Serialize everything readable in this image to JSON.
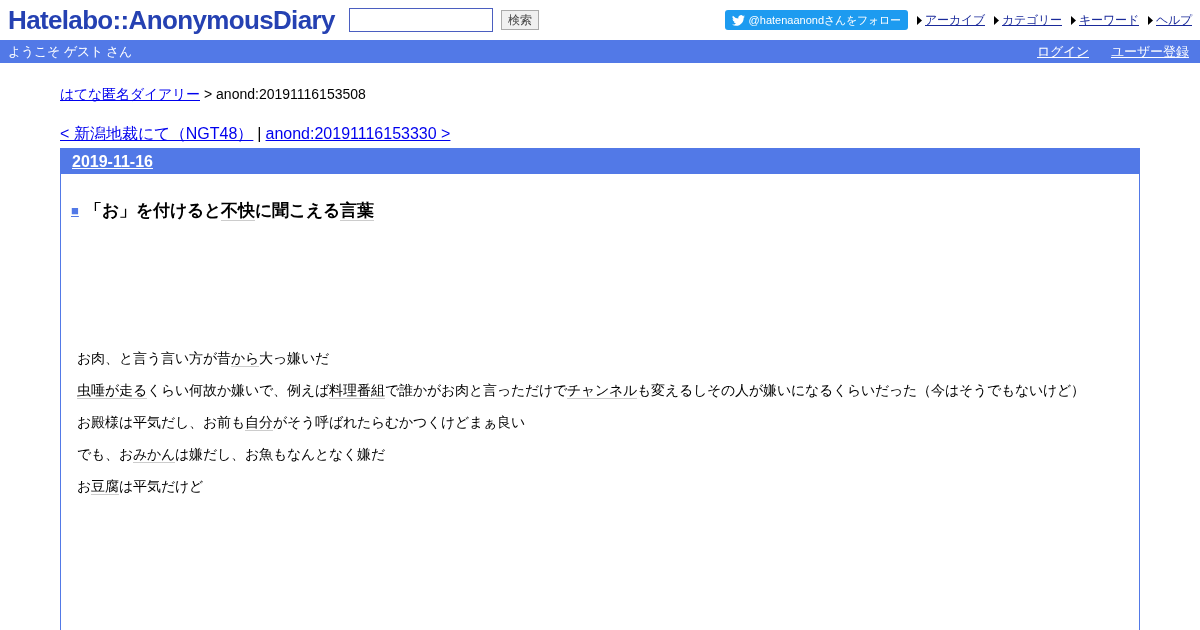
{
  "header": {
    "logo": "Hatelabo::AnonymousDiary",
    "search": {
      "button": "検索"
    },
    "follow_button": "@hatenaanondさんをフォロー",
    "nav_links": [
      "アーカイブ",
      "カテゴリー",
      "キーワード",
      "ヘルプ"
    ]
  },
  "userbar": {
    "greeting": "ようこそ ゲスト さん",
    "links": [
      "ログイン",
      "ユーザー登録"
    ]
  },
  "breadcrumb": {
    "link": "はてな匿名ダイアリー",
    "current": "> anond:20191116153508"
  },
  "pager": {
    "prev": "< 新潟地裁にて（NGT48）",
    "separator": "|",
    "next": "anond:20191116153330 >"
  },
  "day": {
    "date": "2019-11-16",
    "section": {
      "marker": "■",
      "title": [
        {
          "text": "「お」を付けると",
          "keyword": false
        },
        {
          "text": "不快",
          "keyword": true
        },
        {
          "text": "に聞こえる",
          "keyword": false
        },
        {
          "text": "言葉",
          "keyword": true
        }
      ],
      "paragraphs": [
        [
          {
            "text": "お肉、と言う言い方が昔",
            "keyword": false
          },
          {
            "text": "から",
            "keyword": true
          },
          {
            "text": "大っ嫌いだ",
            "keyword": false
          }
        ],
        [
          {
            "text": "虫唾が走る",
            "keyword": true
          },
          {
            "text": "くらい何故か嫌いで、例えば",
            "keyword": false
          },
          {
            "text": "料理番組",
            "keyword": true
          },
          {
            "text": "で誰かがお肉と言っただけで",
            "keyword": false
          },
          {
            "text": "チャンネル",
            "keyword": true
          },
          {
            "text": "も変えるしその人が嫌いになるくらいだった（今はそうでもないけど）",
            "keyword": false
          }
        ],
        [
          {
            "text": "お殿様は平気だし、お前も",
            "keyword": false
          },
          {
            "text": "自分",
            "keyword": true
          },
          {
            "text": "がそう呼ばれたらむかつくけどまぁ良い",
            "keyword": false
          }
        ],
        [
          {
            "text": "でも、お",
            "keyword": false
          },
          {
            "text": "みかん",
            "keyword": true
          },
          {
            "text": "は嫌だし、お魚もなんとなく嫌だ",
            "keyword": false
          }
        ],
        [
          {
            "text": "お",
            "keyword": false
          },
          {
            "text": "豆腐",
            "keyword": true
          },
          {
            "text": "は平気だけど",
            "keyword": false
          }
        ]
      ]
    }
  }
}
